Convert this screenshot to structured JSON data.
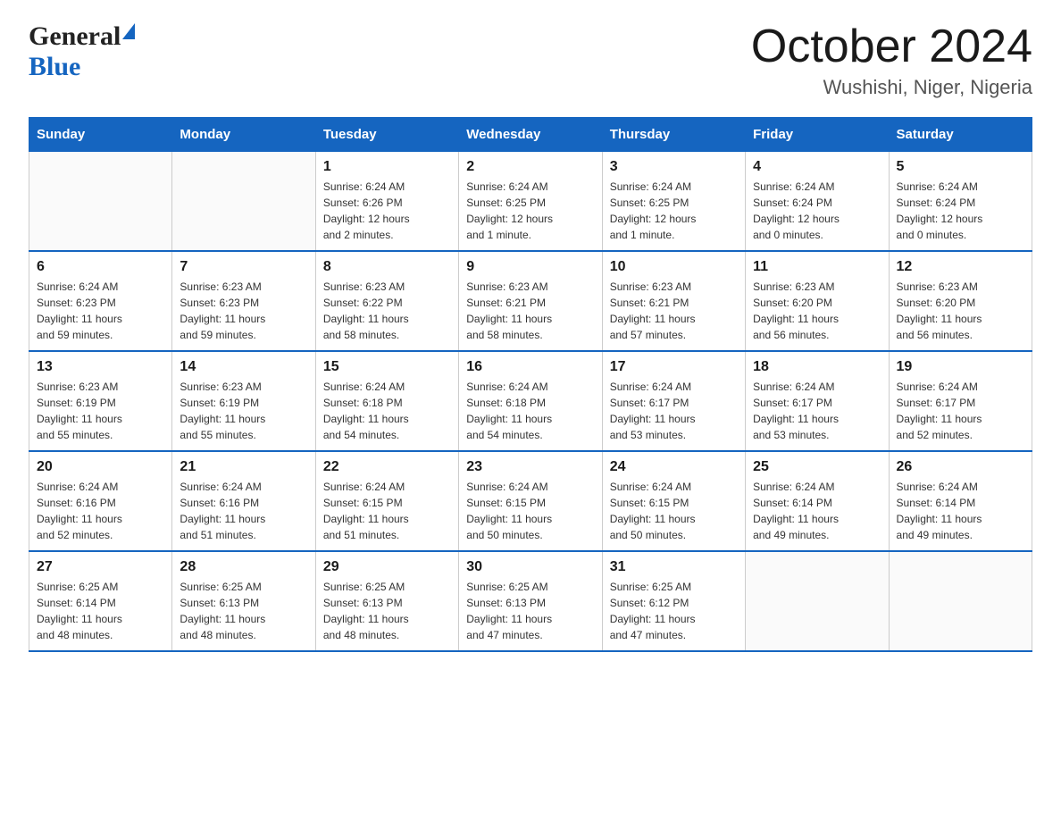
{
  "header": {
    "logo_general": "General",
    "logo_blue": "Blue",
    "month_title": "October 2024",
    "location": "Wushishi, Niger, Nigeria"
  },
  "calendar": {
    "days_of_week": [
      "Sunday",
      "Monday",
      "Tuesday",
      "Wednesday",
      "Thursday",
      "Friday",
      "Saturday"
    ],
    "weeks": [
      [
        {
          "day": "",
          "info": ""
        },
        {
          "day": "",
          "info": ""
        },
        {
          "day": "1",
          "info": "Sunrise: 6:24 AM\nSunset: 6:26 PM\nDaylight: 12 hours\nand 2 minutes."
        },
        {
          "day": "2",
          "info": "Sunrise: 6:24 AM\nSunset: 6:25 PM\nDaylight: 12 hours\nand 1 minute."
        },
        {
          "day": "3",
          "info": "Sunrise: 6:24 AM\nSunset: 6:25 PM\nDaylight: 12 hours\nand 1 minute."
        },
        {
          "day": "4",
          "info": "Sunrise: 6:24 AM\nSunset: 6:24 PM\nDaylight: 12 hours\nand 0 minutes."
        },
        {
          "day": "5",
          "info": "Sunrise: 6:24 AM\nSunset: 6:24 PM\nDaylight: 12 hours\nand 0 minutes."
        }
      ],
      [
        {
          "day": "6",
          "info": "Sunrise: 6:24 AM\nSunset: 6:23 PM\nDaylight: 11 hours\nand 59 minutes."
        },
        {
          "day": "7",
          "info": "Sunrise: 6:23 AM\nSunset: 6:23 PM\nDaylight: 11 hours\nand 59 minutes."
        },
        {
          "day": "8",
          "info": "Sunrise: 6:23 AM\nSunset: 6:22 PM\nDaylight: 11 hours\nand 58 minutes."
        },
        {
          "day": "9",
          "info": "Sunrise: 6:23 AM\nSunset: 6:21 PM\nDaylight: 11 hours\nand 58 minutes."
        },
        {
          "day": "10",
          "info": "Sunrise: 6:23 AM\nSunset: 6:21 PM\nDaylight: 11 hours\nand 57 minutes."
        },
        {
          "day": "11",
          "info": "Sunrise: 6:23 AM\nSunset: 6:20 PM\nDaylight: 11 hours\nand 56 minutes."
        },
        {
          "day": "12",
          "info": "Sunrise: 6:23 AM\nSunset: 6:20 PM\nDaylight: 11 hours\nand 56 minutes."
        }
      ],
      [
        {
          "day": "13",
          "info": "Sunrise: 6:23 AM\nSunset: 6:19 PM\nDaylight: 11 hours\nand 55 minutes."
        },
        {
          "day": "14",
          "info": "Sunrise: 6:23 AM\nSunset: 6:19 PM\nDaylight: 11 hours\nand 55 minutes."
        },
        {
          "day": "15",
          "info": "Sunrise: 6:24 AM\nSunset: 6:18 PM\nDaylight: 11 hours\nand 54 minutes."
        },
        {
          "day": "16",
          "info": "Sunrise: 6:24 AM\nSunset: 6:18 PM\nDaylight: 11 hours\nand 54 minutes."
        },
        {
          "day": "17",
          "info": "Sunrise: 6:24 AM\nSunset: 6:17 PM\nDaylight: 11 hours\nand 53 minutes."
        },
        {
          "day": "18",
          "info": "Sunrise: 6:24 AM\nSunset: 6:17 PM\nDaylight: 11 hours\nand 53 minutes."
        },
        {
          "day": "19",
          "info": "Sunrise: 6:24 AM\nSunset: 6:17 PM\nDaylight: 11 hours\nand 52 minutes."
        }
      ],
      [
        {
          "day": "20",
          "info": "Sunrise: 6:24 AM\nSunset: 6:16 PM\nDaylight: 11 hours\nand 52 minutes."
        },
        {
          "day": "21",
          "info": "Sunrise: 6:24 AM\nSunset: 6:16 PM\nDaylight: 11 hours\nand 51 minutes."
        },
        {
          "day": "22",
          "info": "Sunrise: 6:24 AM\nSunset: 6:15 PM\nDaylight: 11 hours\nand 51 minutes."
        },
        {
          "day": "23",
          "info": "Sunrise: 6:24 AM\nSunset: 6:15 PM\nDaylight: 11 hours\nand 50 minutes."
        },
        {
          "day": "24",
          "info": "Sunrise: 6:24 AM\nSunset: 6:15 PM\nDaylight: 11 hours\nand 50 minutes."
        },
        {
          "day": "25",
          "info": "Sunrise: 6:24 AM\nSunset: 6:14 PM\nDaylight: 11 hours\nand 49 minutes."
        },
        {
          "day": "26",
          "info": "Sunrise: 6:24 AM\nSunset: 6:14 PM\nDaylight: 11 hours\nand 49 minutes."
        }
      ],
      [
        {
          "day": "27",
          "info": "Sunrise: 6:25 AM\nSunset: 6:14 PM\nDaylight: 11 hours\nand 48 minutes."
        },
        {
          "day": "28",
          "info": "Sunrise: 6:25 AM\nSunset: 6:13 PM\nDaylight: 11 hours\nand 48 minutes."
        },
        {
          "day": "29",
          "info": "Sunrise: 6:25 AM\nSunset: 6:13 PM\nDaylight: 11 hours\nand 48 minutes."
        },
        {
          "day": "30",
          "info": "Sunrise: 6:25 AM\nSunset: 6:13 PM\nDaylight: 11 hours\nand 47 minutes."
        },
        {
          "day": "31",
          "info": "Sunrise: 6:25 AM\nSunset: 6:12 PM\nDaylight: 11 hours\nand 47 minutes."
        },
        {
          "day": "",
          "info": ""
        },
        {
          "day": "",
          "info": ""
        }
      ]
    ]
  }
}
